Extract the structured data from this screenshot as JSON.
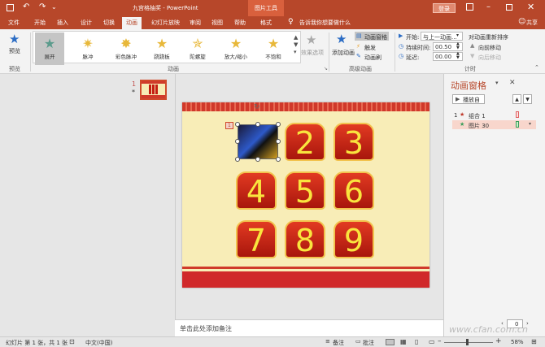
{
  "app": {
    "doc_title": "九宫格抽奖 - PowerPoint",
    "context_tool": "图片工具",
    "login_label": "登录",
    "share_label": "共享"
  },
  "tabs": [
    "文件",
    "开始",
    "插入",
    "设计",
    "切换",
    "动画",
    "幻灯片放映",
    "审阅",
    "视图",
    "帮助",
    "格式"
  ],
  "tell_me": "告诉我你想要做什么",
  "ribbon": {
    "preview_label": "预览",
    "preview_group": "预览",
    "animation_group": "动画",
    "animations": [
      "展开",
      "脉冲",
      "彩色脉冲",
      "跷跷板",
      "陀螺旋",
      "放大/缩小",
      "不饱和"
    ],
    "effect_options": "效果选项",
    "add_animation": "添加动画",
    "anim_pane_btn": "动画窗格",
    "trigger_btn": "触发",
    "anim_painter_btn": "动画刷",
    "advanced_group": "高级动画",
    "start_label": "开始:",
    "start_value": "与上一动画...",
    "duration_label": "持续时间:",
    "duration_value": "00.50",
    "delay_label": "延迟:",
    "delay_value": "00.00",
    "reorder_label": "对动画重新排序",
    "move_earlier": "向前移动",
    "move_later": "向后移动",
    "timing_group": "计时"
  },
  "slides_panel": {
    "slide_number": "1",
    "slide_marker": "*"
  },
  "slide": {
    "numbers": [
      "2",
      "3",
      "4",
      "5",
      "6",
      "7",
      "8",
      "9"
    ],
    "anim_tag": "1"
  },
  "notes_placeholder": "单击此处添加备注",
  "anim_pane": {
    "title": "动画窗格",
    "play_label": "播放自",
    "items": [
      {
        "num": "1",
        "label": "组合 1"
      },
      {
        "num": "",
        "label": "图片 30"
      }
    ],
    "spinner_value": "0"
  },
  "status": {
    "slide_info": "幻灯片 第 1 张，共 1 张",
    "language": "中文(中国)",
    "notes_btn": "备注",
    "comments_btn": "批注",
    "zoom": "58%"
  },
  "watermark": "www.cfan.com.cn",
  "colors": {
    "accent": "#b7472a",
    "tile_red": "#c41e12",
    "tile_text": "#f9e53e",
    "slide_bg": "#f8edb7"
  }
}
